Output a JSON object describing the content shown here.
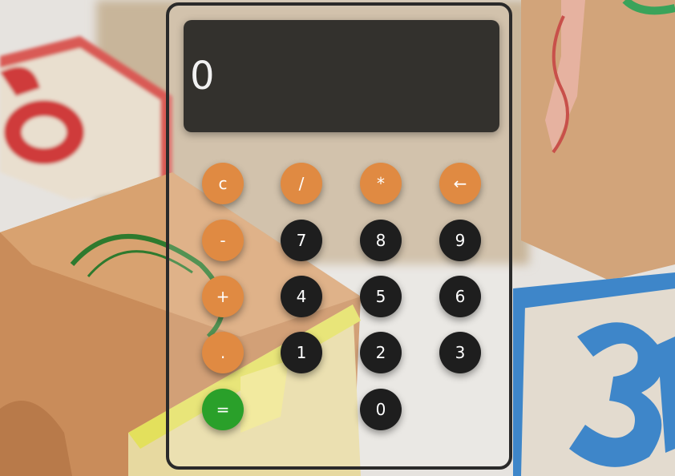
{
  "display": {
    "value": "0"
  },
  "buttons": {
    "clear": "c",
    "divide": "/",
    "multiply": "*",
    "backspace": "←",
    "minus": "-",
    "seven": "7",
    "eight": "8",
    "nine": "9",
    "plus": "+",
    "four": "4",
    "five": "5",
    "six": "6",
    "dot": ".",
    "one": "1",
    "two": "2",
    "three": "3",
    "equals": "=",
    "zero": "0"
  },
  "colors": {
    "operator": "#e08a42",
    "number": "#1e1e1e",
    "equals": "#2aa02a",
    "display": "#191919",
    "frame": "#2a2a2a"
  }
}
